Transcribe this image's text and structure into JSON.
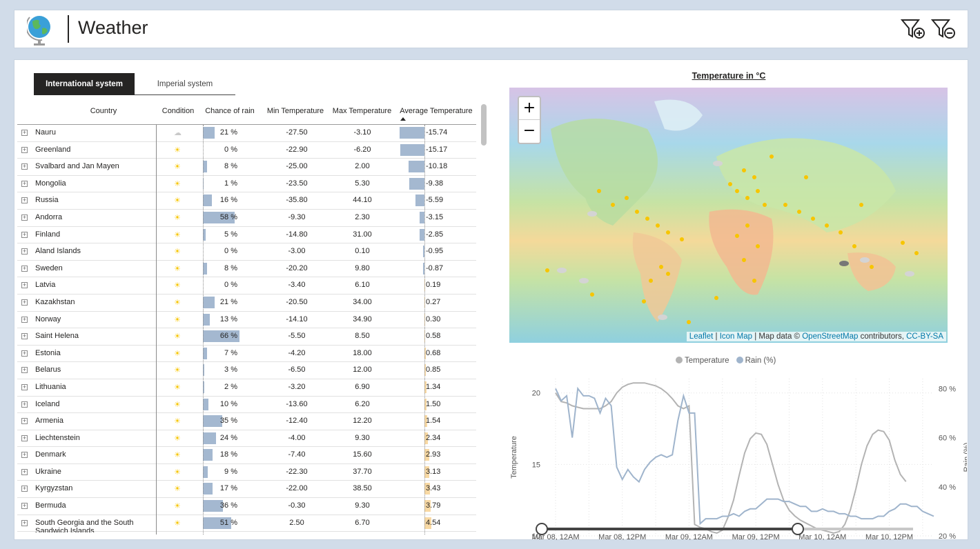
{
  "header": {
    "title": "Weather"
  },
  "tabs": [
    "International system",
    "Imperial system"
  ],
  "table": {
    "columns": [
      "Country",
      "Condition",
      "Chance of rain",
      "Min Temperature",
      "Max Temperature",
      "Average Temperature"
    ],
    "rows": [
      {
        "country": "Nauru",
        "cond": "cloud",
        "rain": "21 %",
        "rainv": 21,
        "min": "-27.50",
        "max": "-3.10",
        "avg": "-15.74",
        "avgv": -15.74
      },
      {
        "country": "Greenland",
        "cond": "sun",
        "rain": "0 %",
        "rainv": 0,
        "min": "-22.90",
        "max": "-6.20",
        "avg": "-15.17",
        "avgv": -15.17
      },
      {
        "country": "Svalbard and Jan Mayen",
        "cond": "sun",
        "rain": "8 %",
        "rainv": 8,
        "min": "-25.00",
        "max": "2.00",
        "avg": "-10.18",
        "avgv": -10.18
      },
      {
        "country": "Mongolia",
        "cond": "sun",
        "rain": "1 %",
        "rainv": 1,
        "min": "-23.50",
        "max": "5.30",
        "avg": "-9.38",
        "avgv": -9.38
      },
      {
        "country": "Russia",
        "cond": "sun",
        "rain": "16 %",
        "rainv": 16,
        "min": "-35.80",
        "max": "44.10",
        "avg": "-5.59",
        "avgv": -5.59
      },
      {
        "country": "Andorra",
        "cond": "sun",
        "rain": "58 %",
        "rainv": 58,
        "min": "-9.30",
        "max": "2.30",
        "avg": "-3.15",
        "avgv": -3.15
      },
      {
        "country": "Finland",
        "cond": "sun",
        "rain": "5 %",
        "rainv": 5,
        "min": "-14.80",
        "max": "31.00",
        "avg": "-2.85",
        "avgv": -2.85
      },
      {
        "country": "Aland Islands",
        "cond": "sun",
        "rain": "0 %",
        "rainv": 0,
        "min": "-3.00",
        "max": "0.10",
        "avg": "-0.95",
        "avgv": -0.95
      },
      {
        "country": "Sweden",
        "cond": "sun",
        "rain": "8 %",
        "rainv": 8,
        "min": "-20.20",
        "max": "9.80",
        "avg": "-0.87",
        "avgv": -0.87
      },
      {
        "country": "Latvia",
        "cond": "sun",
        "rain": "0 %",
        "rainv": 0,
        "min": "-3.40",
        "max": "6.10",
        "avg": "0.19",
        "avgv": 0.19
      },
      {
        "country": "Kazakhstan",
        "cond": "sun",
        "rain": "21 %",
        "rainv": 21,
        "min": "-20.50",
        "max": "34.00",
        "avg": "0.27",
        "avgv": 0.27
      },
      {
        "country": "Norway",
        "cond": "sun",
        "rain": "13 %",
        "rainv": 13,
        "min": "-14.10",
        "max": "34.90",
        "avg": "0.30",
        "avgv": 0.3
      },
      {
        "country": "Saint Helena",
        "cond": "sun",
        "rain": "66 %",
        "rainv": 66,
        "min": "-5.50",
        "max": "8.50",
        "avg": "0.58",
        "avgv": 0.58
      },
      {
        "country": "Estonia",
        "cond": "sun",
        "rain": "7 %",
        "rainv": 7,
        "min": "-4.20",
        "max": "18.00",
        "avg": "0.68",
        "avgv": 0.68
      },
      {
        "country": "Belarus",
        "cond": "sun",
        "rain": "3 %",
        "rainv": 3,
        "min": "-6.50",
        "max": "12.00",
        "avg": "0.85",
        "avgv": 0.85
      },
      {
        "country": "Lithuania",
        "cond": "sun",
        "rain": "2 %",
        "rainv": 2,
        "min": "-3.20",
        "max": "6.90",
        "avg": "1.34",
        "avgv": 1.34
      },
      {
        "country": "Iceland",
        "cond": "sun",
        "rain": "10 %",
        "rainv": 10,
        "min": "-13.60",
        "max": "6.20",
        "avg": "1.50",
        "avgv": 1.5
      },
      {
        "country": "Armenia",
        "cond": "sun",
        "rain": "35 %",
        "rainv": 35,
        "min": "-12.40",
        "max": "12.20",
        "avg": "1.54",
        "avgv": 1.54
      },
      {
        "country": "Liechtenstein",
        "cond": "sun",
        "rain": "24 %",
        "rainv": 24,
        "min": "-4.00",
        "max": "9.30",
        "avg": "2.34",
        "avgv": 2.34
      },
      {
        "country": "Denmark",
        "cond": "sun",
        "rain": "18 %",
        "rainv": 18,
        "min": "-7.40",
        "max": "15.60",
        "avg": "2.93",
        "avgv": 2.93
      },
      {
        "country": "Ukraine",
        "cond": "sun",
        "rain": "9 %",
        "rainv": 9,
        "min": "-22.30",
        "max": "37.70",
        "avg": "3.13",
        "avgv": 3.13
      },
      {
        "country": "Kyrgyzstan",
        "cond": "sun",
        "rain": "17 %",
        "rainv": 17,
        "min": "-22.00",
        "max": "38.50",
        "avg": "3.43",
        "avgv": 3.43
      },
      {
        "country": "Bermuda",
        "cond": "sun",
        "rain": "36 %",
        "rainv": 36,
        "min": "-0.30",
        "max": "9.30",
        "avg": "3.79",
        "avgv": 3.79
      },
      {
        "country": "South Georgia and the South Sandwich Islands",
        "cond": "sun",
        "rain": "51 %",
        "rainv": 51,
        "min": "2.50",
        "max": "6.70",
        "avg": "4.54",
        "avgv": 4.54
      }
    ]
  },
  "map": {
    "title": "Temperature in °C",
    "attribution": {
      "leaflet": "Leaflet",
      "sep1": " | ",
      "iconmap": "Icon Map",
      "mapdata": " | Map data © ",
      "osm": "OpenStreetMap",
      "contrib": " contributors, ",
      "license": "CC-BY-SA"
    }
  },
  "chart_data": {
    "type": "line",
    "legend": [
      "Temperature",
      "Rain (%)"
    ],
    "ylabel_left": "Temperature",
    "ylabel_right": "Rain (%)",
    "ylim_left": [
      10,
      21
    ],
    "ylim_right": [
      20,
      84
    ],
    "y_ticks_left": [
      "10",
      "15",
      "20"
    ],
    "y_ticks_right": [
      "20 %",
      "40 %",
      "60 %",
      "80 %"
    ],
    "x_ticks": [
      "Mar 08, 12AM",
      "Mar 08, 12PM",
      "Mar 09, 12AM",
      "Mar 09, 12PM",
      "Mar 10, 12AM",
      "Mar 10, 12PM"
    ],
    "x_hours": [
      0,
      1,
      2,
      3,
      4,
      5,
      6,
      7,
      8,
      9,
      10,
      11,
      12,
      13,
      14,
      15,
      16,
      17,
      18,
      19,
      20,
      21,
      22,
      23,
      24,
      25,
      26,
      27,
      28,
      29,
      30,
      31,
      32,
      33,
      34,
      35,
      36,
      37,
      38,
      39,
      40,
      41,
      42,
      43,
      44,
      45,
      46,
      47,
      48,
      49,
      50,
      51,
      52,
      53,
      54,
      55,
      56,
      57,
      58,
      59,
      60,
      61,
      62,
      63,
      64,
      65,
      66,
      67,
      68
    ],
    "series": [
      {
        "name": "Temperature",
        "color": "#b3b3b3",
        "values": [
          20.0,
          19.4,
          19.3,
          19.1,
          19.0,
          18.9,
          18.9,
          18.9,
          18.9,
          19.1,
          19.4,
          20.0,
          20.4,
          20.6,
          20.7,
          20.7,
          20.7,
          20.6,
          20.5,
          20.3,
          20.0,
          19.6,
          19.1,
          18.9,
          19.1,
          10.8,
          10.6,
          10.5,
          10.3,
          10.2,
          10.4,
          11.3,
          12.5,
          14.2,
          15.8,
          16.8,
          17.2,
          17.1,
          16.4,
          15.0,
          13.6,
          12.5,
          11.8,
          11.4,
          11.1,
          10.9,
          10.7,
          10.5,
          10.4,
          10.3,
          10.2,
          10.3,
          10.8,
          11.8,
          13.3,
          15.0,
          16.3,
          17.1,
          17.4,
          17.3,
          16.7,
          15.3,
          14.3,
          13.8
        ]
      },
      {
        "name": "Rain (%)",
        "color": "#9fb4cc",
        "values": [
          80,
          75,
          77,
          60,
          80,
          77,
          77,
          76,
          70,
          76,
          73,
          48,
          43,
          47,
          44,
          42,
          47,
          50,
          52,
          53,
          52,
          53,
          67,
          77,
          70,
          70,
          25,
          27,
          27,
          27,
          28,
          28,
          29,
          28,
          30,
          31,
          31,
          33,
          35,
          35,
          35,
          34,
          34,
          33,
          32,
          32,
          30,
          30,
          31,
          30,
          30,
          29,
          29,
          28,
          28,
          27,
          27,
          27,
          28,
          28,
          30,
          31,
          33,
          33,
          32,
          32,
          30,
          29,
          28
        ]
      }
    ],
    "slider": {
      "start": 0,
      "end": 0.69
    }
  }
}
